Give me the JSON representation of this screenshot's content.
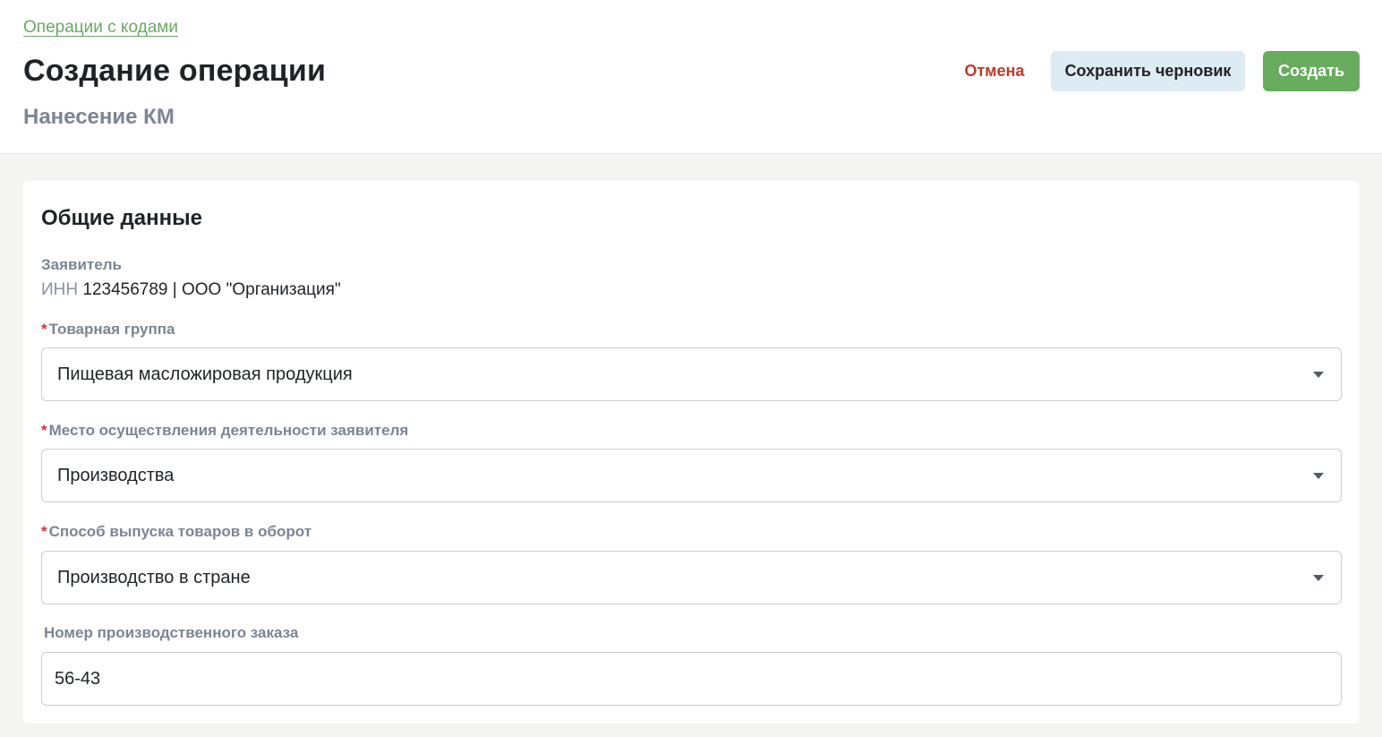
{
  "header": {
    "breadcrumb": "Операции с кодами",
    "title": "Создание операции",
    "subtitle": "Нанесение КМ",
    "actions": {
      "cancel_label": "Отмена",
      "draft_label": "Сохранить черновик",
      "create_label": "Создать"
    }
  },
  "form": {
    "section_title": "Общие данные",
    "applicant": {
      "label": "Заявитель",
      "inn_prefix": "ИНН",
      "value": "123456789 | ООО \"Организация\""
    },
    "required_mark": "*",
    "product_group": {
      "label": "Товарная группа",
      "value": "Пищевая масложировая продукция"
    },
    "activity_place": {
      "label": "Место осуществления деятельности заявителя",
      "value": "Производства"
    },
    "release_method": {
      "label": "Способ выпуска товаров в оборот",
      "value": "Производство в стране"
    },
    "order_number": {
      "label": "Номер производственного заказа",
      "value": "56-43"
    }
  },
  "colors": {
    "accent_green": "#68ac5e",
    "link_green": "#6aa964",
    "cancel_red": "#c0392b",
    "draft_bg": "#dcecf2",
    "required_red": "#d2332f"
  },
  "icons": {
    "dropdown": "chevron-down-icon"
  }
}
